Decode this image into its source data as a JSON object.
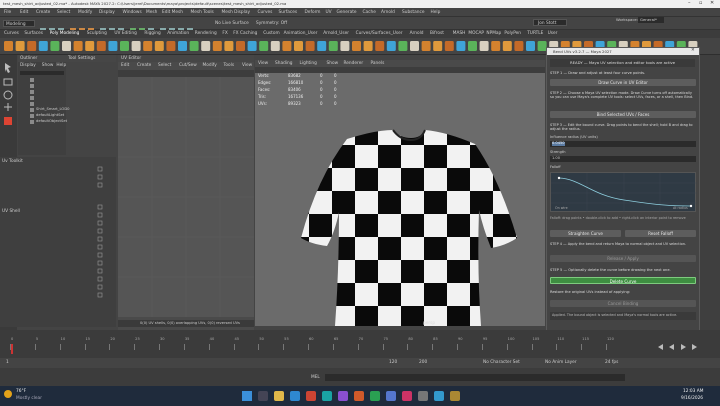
{
  "window": {
    "title": "test_mesh_shirt_adjusted_02.ma* - Autodesk MAYA 2027.2: C:\\Users\\jerel\\Documents\\maya\\projects\\default\\scenes\\test_mesh_shirt_adjusted_02.ma"
  },
  "menu": [
    "File",
    "Edit",
    "Create",
    "Select",
    "Modify",
    "Display",
    "Windows",
    "Mesh",
    "Edit Mesh",
    "Mesh Tools",
    "Mesh Display",
    "Curves",
    "Surfaces",
    "Deform",
    "UV",
    "Generate",
    "Cache",
    "Arnold",
    "Substance",
    "Help"
  ],
  "status": {
    "mode": "Modeling",
    "live_surface": "No Live Surface",
    "symmetry": "Symmetry: Off",
    "workspace_label": "Workspace:",
    "workspace": "General*",
    "user": "Jon Stott"
  },
  "shelf_tabs": [
    "Curves",
    "Surfaces",
    "Poly Modeling",
    "Sculpting",
    "UV Editing",
    "Rigging",
    "Animation",
    "Rendering",
    "FX",
    "FX Caching",
    "Custom",
    "Animation_User",
    "Arnold_User",
    "Curves/Surfaces_User",
    "Arnold",
    "Bifrost",
    "MASH",
    "MOCAP",
    "NPMap",
    "PolyPen",
    "TURTLE",
    "User"
  ],
  "outliner": {
    "title": "Outliner",
    "menus": [
      "Display",
      "Show",
      "Help"
    ],
    "items": [
      "",
      "",
      "",
      "",
      "",
      "Shirt_Smart_LOD0",
      "defaultLightSet",
      "defaultObjectSet"
    ]
  },
  "tool_settings": {
    "title": "Tool Settings",
    "label": "Uv Toolkit",
    "rows": [
      "UV Shell"
    ]
  },
  "uv_editor": {
    "title": "UV Editor",
    "menus": [
      "Edit",
      "Create",
      "Select",
      "Cut/Sew",
      "Modify",
      "Tools",
      "View"
    ],
    "status": "0(0) UV shells, 0(0) overlapping UVs, 0(0) reversed UVs"
  },
  "viewport": {
    "menus": [
      "View",
      "Shading",
      "Lighting",
      "Show",
      "Renderer",
      "Panels"
    ],
    "hud": [
      [
        "Verts:",
        "83682",
        "0",
        "0"
      ],
      [
        "Edges:",
        "166810",
        "0",
        "0"
      ],
      [
        "Faces:",
        "83406",
        "0",
        "0"
      ],
      [
        "Tris:",
        "167136",
        "0",
        "0"
      ],
      [
        "UVs:",
        "89323",
        "0",
        "0"
      ]
    ],
    "camera": "persp"
  },
  "dialog": {
    "title": "Bend UVs v3.2.7 — Maya 2027",
    "ready": "READY — Maya UV selection and editor tools are active",
    "step1": "STEP 1 — Draw and adjust at least four curve points.",
    "btn_curve": "Draw Curve in UV Editor",
    "step2": "STEP 2 — Choose a Maya UV selection mode. Draw Curve turns off automatically so you can use Maya's complete UV tools: select UVs, faces, or a shell, then Bind.",
    "btn_bind": "Bind Selected UVs / Faces",
    "step3": "STEP 3 — Edit the bound curve. Drag points to bend the shell; hold B and drag to adjust the radius.",
    "influence_label": "Influence radius (UV units)",
    "influence_value": "0.0450",
    "strength_label": "Strength",
    "strength_value": "1.00",
    "falloff_label": "Falloff",
    "falloff_on": "On wire",
    "falloff_edge": "At radius",
    "falloff_hint": "Falloff: drag points • double-click to add • right-click an interior point to remove",
    "btn_straighten": "Straighten Curve",
    "btn_reset": "Reset Falloff",
    "step4": "STEP 4 — Apply the bend and return Maya to normal object and UV selection.",
    "btn_release": "Release / Apply",
    "step5": "STEP 5 — Optionally delete the curve before drawing the next one.",
    "btn_delete": "Delete Curve",
    "restore_label": "Restore the original UVs instead of applying:",
    "btn_cancel": "Cancel Binding",
    "footer": "Applied. The bound object is selected and Maya's normal tools are active."
  },
  "timeline": {
    "ticks": [
      "0",
      "5",
      "10",
      "15",
      "20",
      "25",
      "30",
      "35",
      "40",
      "45",
      "50",
      "55",
      "60",
      "65",
      "70",
      "75",
      "80",
      "85",
      "90",
      "95",
      "100",
      "105",
      "110",
      "115",
      "120"
    ],
    "start": "1",
    "end": "120",
    "range_end": "200",
    "current": "1",
    "fps": "24 fps",
    "no_char_set": "No Character Set",
    "no_anim_layer": "No Anim Layer"
  },
  "commandline": {
    "label": "MEL"
  },
  "taskbar": {
    "weather_temp": "76°F",
    "weather_desc": "Mostly clear",
    "time": "12:03 AM",
    "date": "9/16/2026"
  },
  "colors": {
    "accent": "#3e8e41",
    "checker_dark": "#0a0a0a",
    "checker_light": "#f2f2f2",
    "dialog_bg": "#444444"
  }
}
